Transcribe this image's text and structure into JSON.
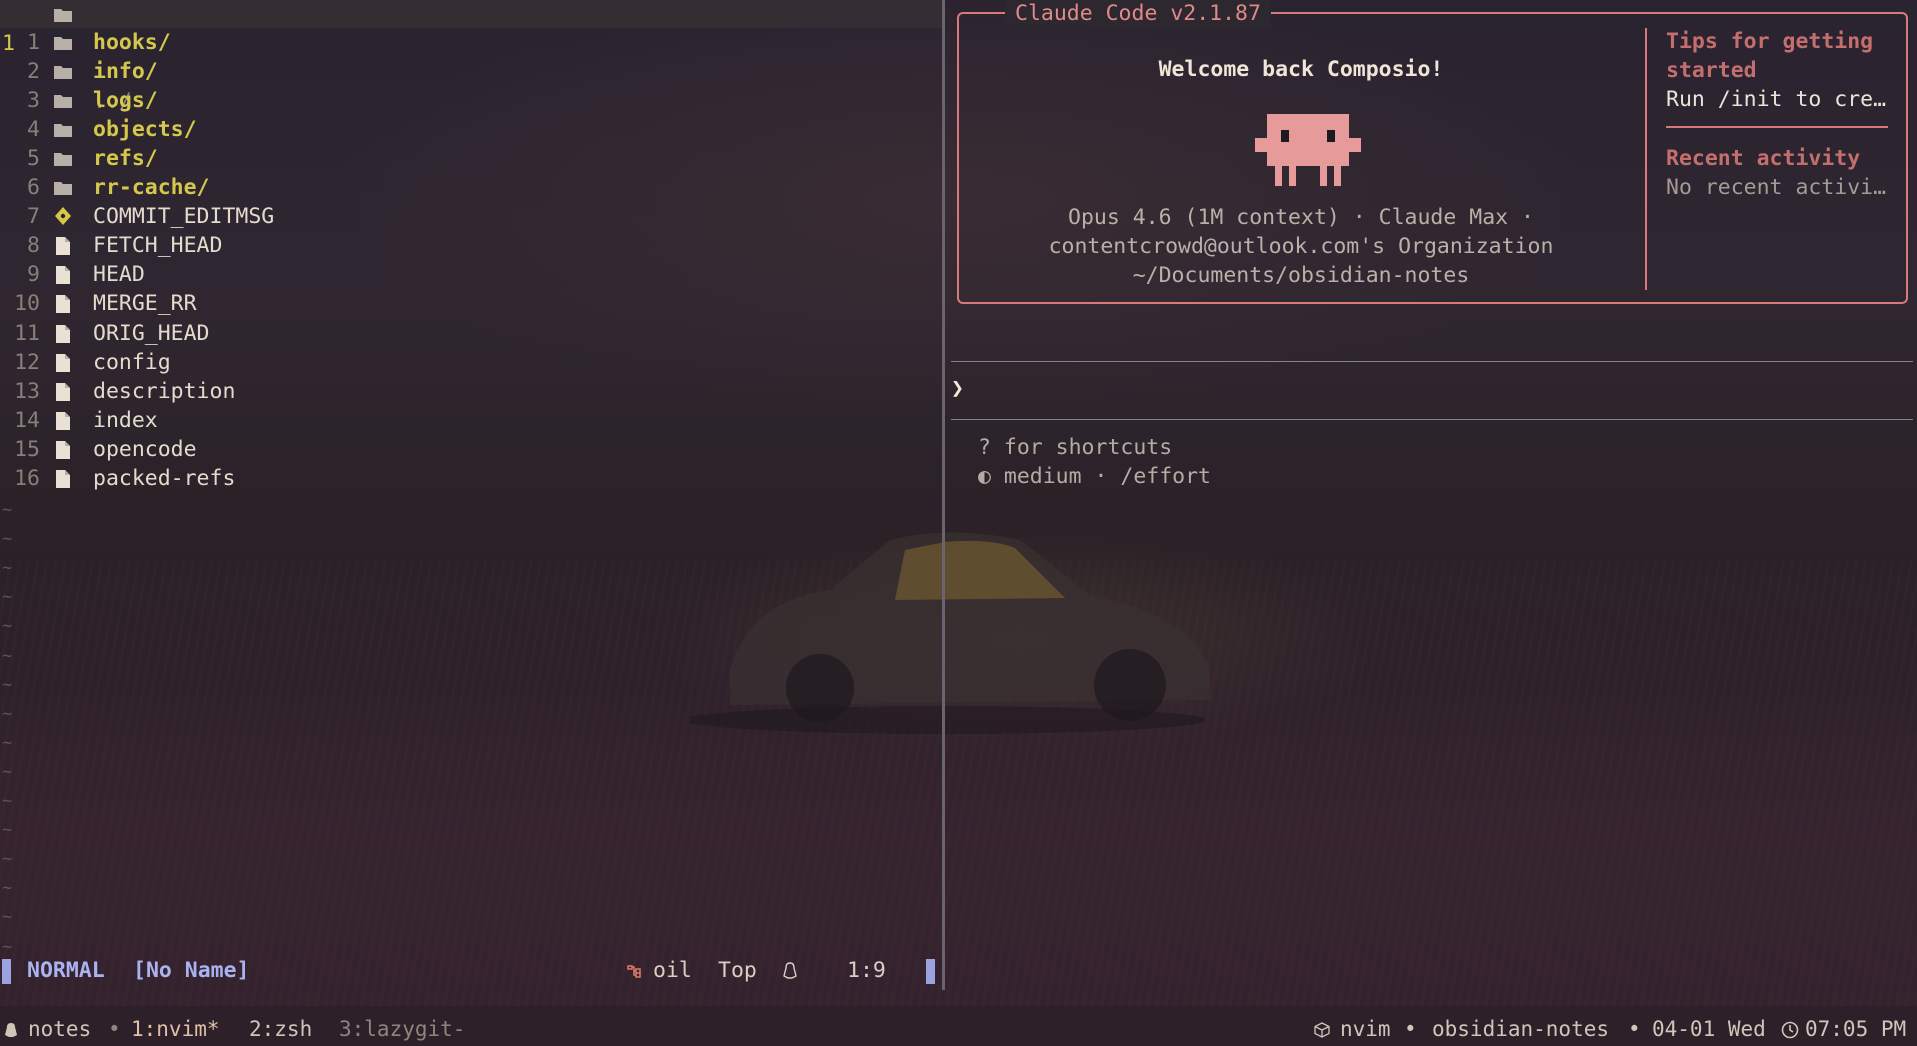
{
  "colors": {
    "directory": "#d4c84c",
    "file": "#e3dccd",
    "claude_accent": "#d97a7a",
    "statusline_accent": "#9aa3e0"
  },
  "oil": {
    "current_line_number": "1",
    "parent_entry": "../",
    "entries": [
      {
        "num": "1",
        "name": "hooks/",
        "kind": "dir",
        "icon": "folder-icon"
      },
      {
        "num": "2",
        "name": "info/",
        "kind": "dir",
        "icon": "folder-icon"
      },
      {
        "num": "3",
        "name": "logs/",
        "kind": "dir",
        "icon": "folder-icon"
      },
      {
        "num": "4",
        "name": "objects/",
        "kind": "dir",
        "icon": "folder-icon"
      },
      {
        "num": "5",
        "name": "refs/",
        "kind": "dir",
        "icon": "folder-icon"
      },
      {
        "num": "6",
        "name": "rr-cache/",
        "kind": "dir",
        "icon": "folder-icon"
      },
      {
        "num": "7",
        "name": "COMMIT_EDITMSG",
        "kind": "file",
        "icon": "git-icon"
      },
      {
        "num": "8",
        "name": "FETCH_HEAD",
        "kind": "file",
        "icon": "file-icon"
      },
      {
        "num": "9",
        "name": "HEAD",
        "kind": "file",
        "icon": "file-icon"
      },
      {
        "num": "10",
        "name": "MERGE_RR",
        "kind": "file",
        "icon": "file-icon"
      },
      {
        "num": "11",
        "name": "ORIG_HEAD",
        "kind": "file",
        "icon": "file-icon"
      },
      {
        "num": "12",
        "name": "config",
        "kind": "file",
        "icon": "file-icon"
      },
      {
        "num": "13",
        "name": "description",
        "kind": "file",
        "icon": "file-icon"
      },
      {
        "num": "14",
        "name": "index",
        "kind": "file",
        "icon": "file-icon"
      },
      {
        "num": "15",
        "name": "opencode",
        "kind": "file",
        "icon": "file-icon"
      },
      {
        "num": "16",
        "name": "packed-refs",
        "kind": "file",
        "icon": "file-icon"
      }
    ],
    "tilde": "~"
  },
  "statusline": {
    "mode": "NORMAL",
    "buffer": "[No Name]",
    "filetype": "oil",
    "position": "Top",
    "cursor": "1:9"
  },
  "claude": {
    "title": "Claude Code v2.1.87",
    "welcome": "Welcome back Composio!",
    "model_line": "Opus 4.6 (1M context) · Claude Max ·",
    "org_line": "contentcrowd@outlook.com's Organization",
    "path_line": "~/Documents/obsidian-notes",
    "tips_title_1": "Tips for getting",
    "tips_title_2": "started",
    "tips_text": "Run /init to cre…",
    "recent_title": "Recent activity",
    "recent_text": "No recent activi…",
    "prompt_symbol": "❯",
    "shortcuts_hint": "? for shortcuts",
    "effort_hint": "◐ medium · /effort"
  },
  "tmux": {
    "session": "notes",
    "sep": "•",
    "windows": [
      {
        "label": "1:nvim*",
        "state": "active"
      },
      {
        "label": "2:zsh",
        "state": "normal"
      },
      {
        "label": "3:lazygit-",
        "state": "inactive"
      }
    ],
    "app": "nvim",
    "project": "obsidian-notes",
    "date": "04-01 Wed",
    "time": "07:05 PM"
  }
}
